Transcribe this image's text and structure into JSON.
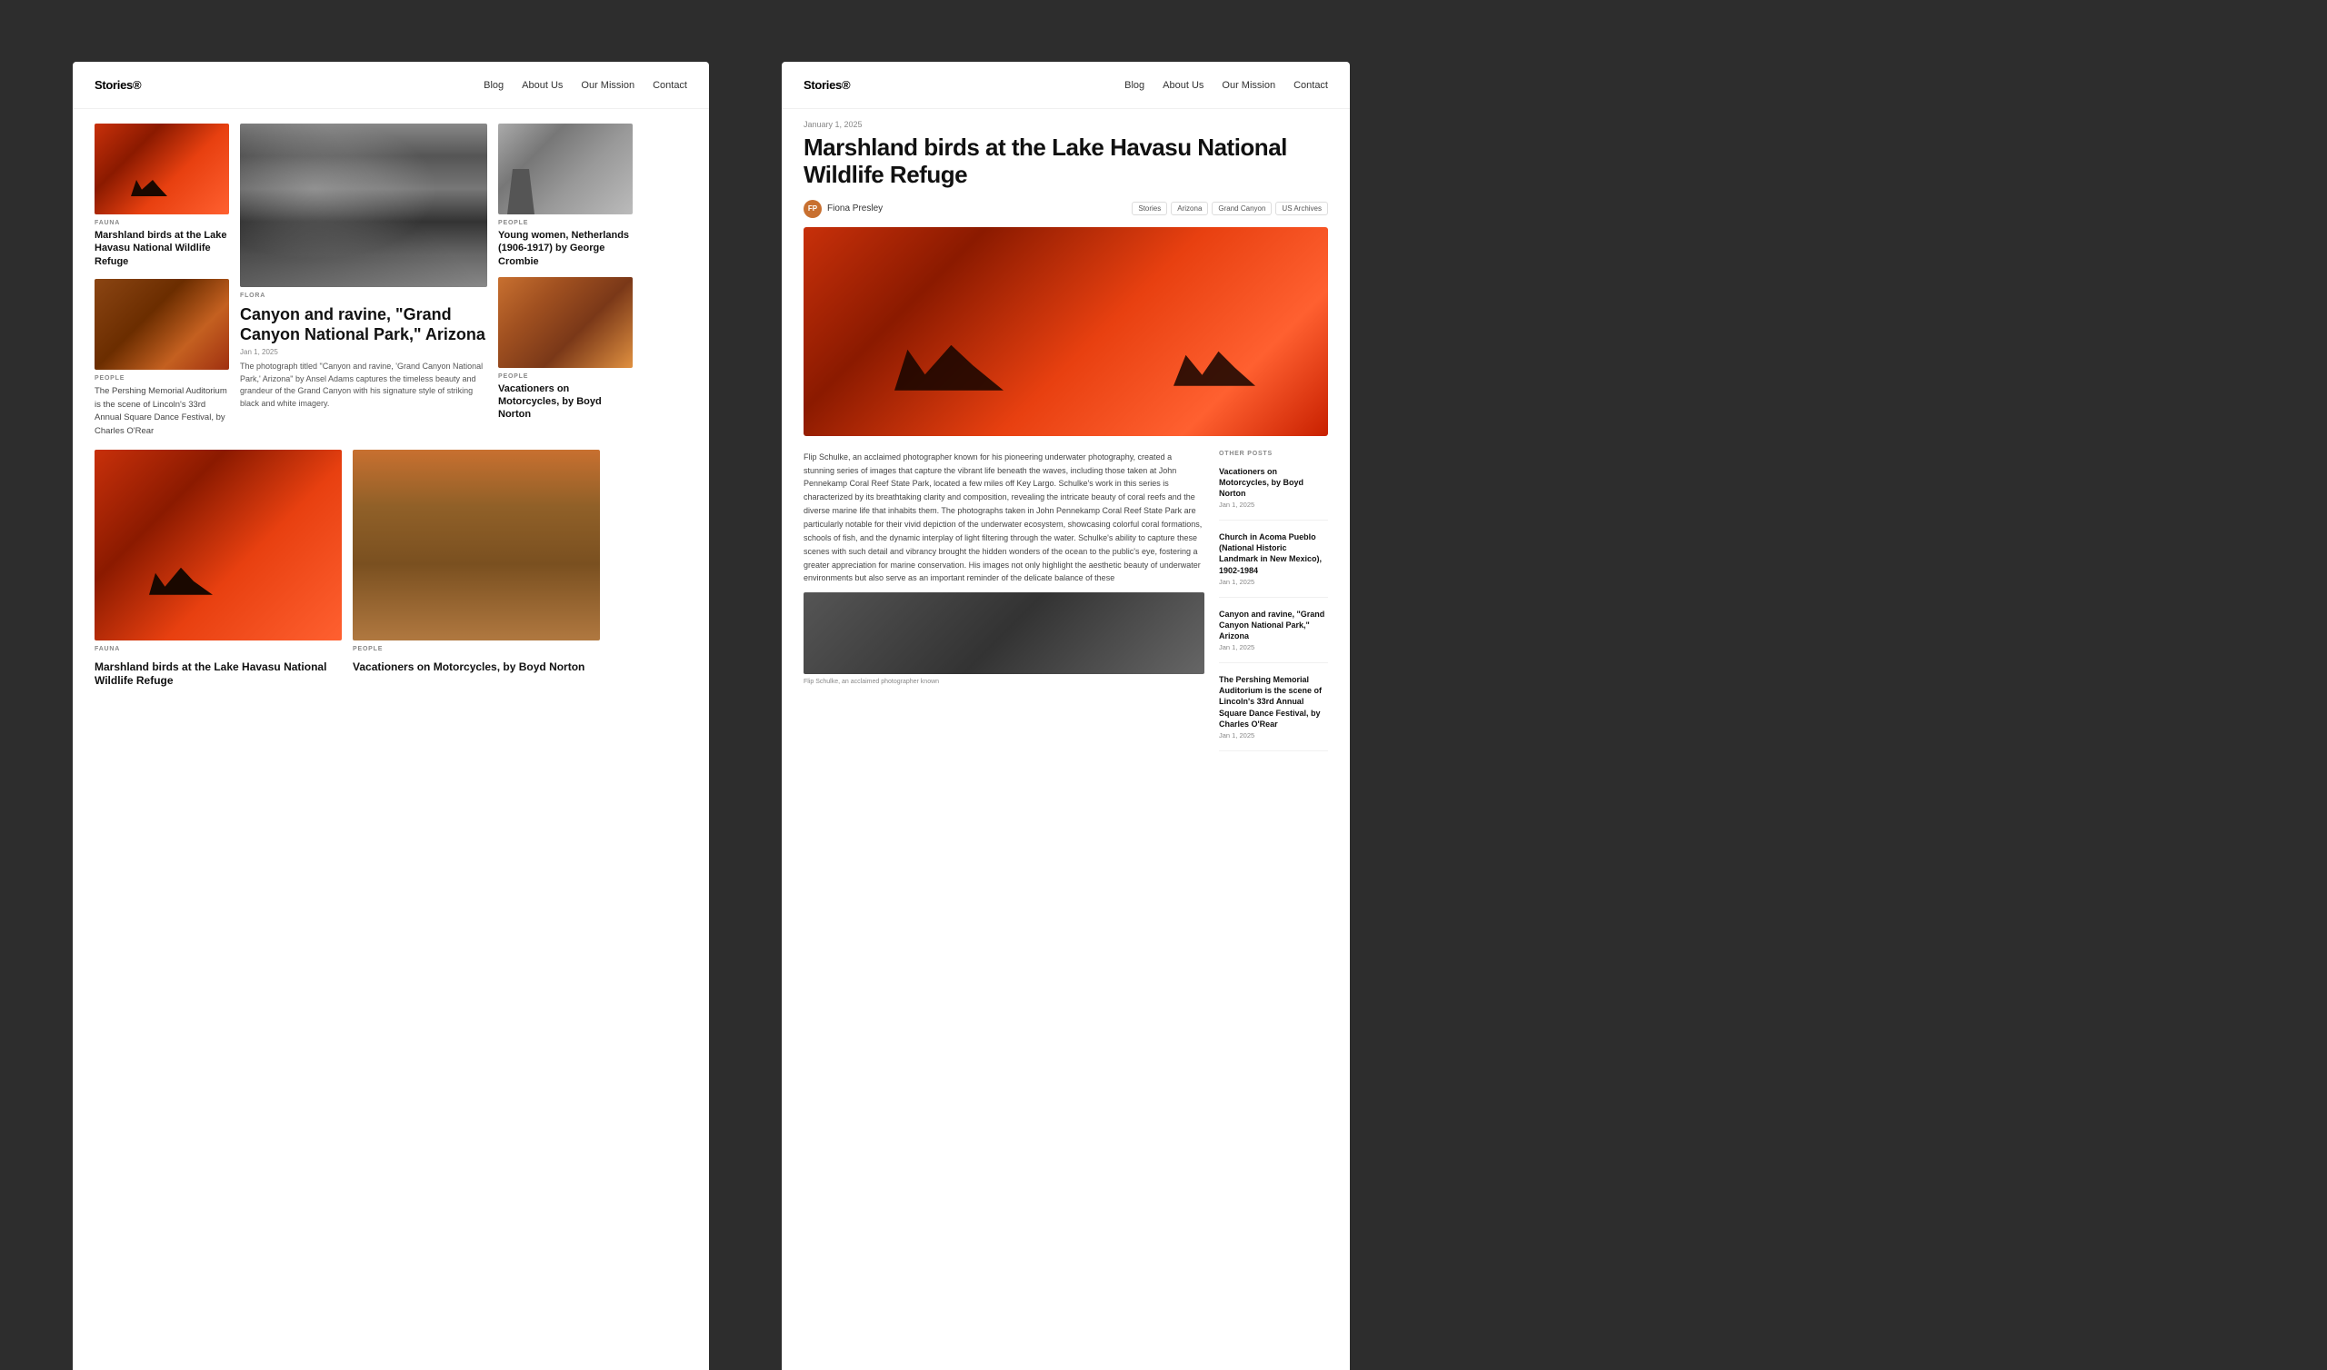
{
  "left": {
    "nav": {
      "logo": "Stories®",
      "links": [
        "Blog",
        "About Us",
        "Our Mission",
        "Contact"
      ]
    },
    "cards": {
      "card1": {
        "category": "FAUNA",
        "title": "Marshland birds at the Lake Havasu National Wildlife Refuge"
      },
      "card2": {
        "category": "FLORA",
        "title": "Canyon and ravine, \"Grand Canyon National Park,\" Arizona",
        "date": "Jan 1, 2025",
        "desc": "The photograph titled \"Canyon and ravine, 'Grand Canyon National Park,' Arizona\" by Ansel Adams captures the timeless beauty and grandeur of the Grand Canyon with his signature style of striking black and white imagery."
      },
      "card3": {
        "category": "PEOPLE",
        "title": "Young women, Netherlands (1906-1917) by George Crombie"
      },
      "card4": {
        "category": "PEOPLE",
        "title": "The Pershing Memorial Auditorium is the scene of Lincoln's 33rd Annual Square Dance Festival, by Charles O'Rear"
      },
      "card5": {
        "category": "PEOPLE",
        "title": "Vacationers on Motorcycles, by Boyd Norton"
      },
      "card6": {
        "category": "FAUNA",
        "title": "Marshland birds at the Lake Havasu National Wildlife Refuge"
      },
      "card7": {
        "category": "PEOPLE",
        "title": "Vacationers on Motorcycles, by Boyd Norton"
      }
    }
  },
  "right": {
    "nav": {
      "logo": "Stories®",
      "links": [
        "Blog",
        "About Us",
        "Our Mission",
        "Contact"
      ]
    },
    "article": {
      "date": "January 1, 2025",
      "title": "Marshland birds at the Lake Havasu National Wildlife Refuge",
      "author": "Fiona Presley",
      "tags": [
        "Stories",
        "Arizona",
        "Grand Canyon",
        "US Archives"
      ],
      "body_p1": "Flip Schulke, an acclaimed photographer known for his pioneering underwater photography, created a stunning series of images that capture the vibrant life beneath the waves, including those taken at John Pennekamp Coral Reef State Park, located a few miles off Key Largo. Schulke's work in this series is characterized by its breathtaking clarity and composition, revealing the intricate beauty of coral reefs and the diverse marine life that inhabits them. The photographs taken in John Pennekamp Coral Reef State Park are particularly notable for their vivid depiction of the underwater ecosystem, showcasing colorful coral formations, schools of fish, and the dynamic interplay of light filtering through the water. Schulke's ability to capture these scenes with such detail and vibrancy brought the hidden wonders of the ocean to the public's eye, fostering a greater appreciation for marine conservation. His images not only highlight the aesthetic beauty of underwater environments but also serve as an important reminder of the delicate balance of these",
      "inline_caption": "Flip Schulke, an acclaimed photographer known",
      "other_posts_label": "OTHER POSTS",
      "other_posts": [
        {
          "title": "Vacationers on Motorcycles, by Boyd Norton",
          "date": "Jan 1, 2025"
        },
        {
          "title": "Church in Acoma Pueblo (National Historic Landmark in New Mexico), 1902-1984",
          "date": "Jan 1, 2025"
        },
        {
          "title": "Canyon and ravine, \"Grand Canyon National Park,\" Arizona",
          "date": "Jan 1, 2025"
        },
        {
          "title": "The Pershing Memorial Auditorium is the scene of Lincoln's 33rd Annual Square Dance Festival, by Charles O'Rear",
          "date": "Jan 1, 2025"
        }
      ]
    }
  }
}
